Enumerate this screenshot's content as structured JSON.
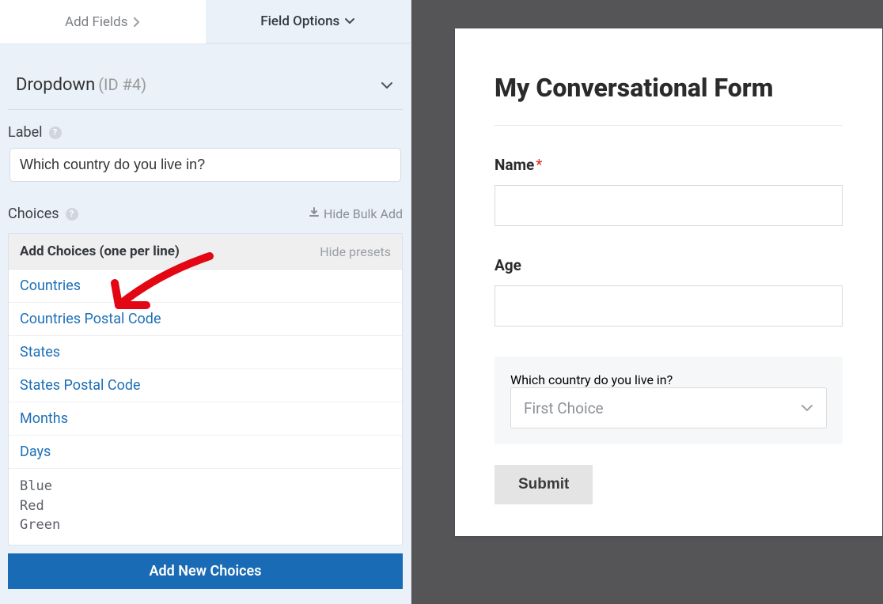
{
  "tabs": {
    "add_fields": "Add Fields",
    "field_options": "Field Options"
  },
  "section": {
    "title": "Dropdown",
    "id_label": "(ID #4)"
  },
  "label_field": {
    "label": "Label",
    "value": "Which country do you live in?"
  },
  "choices": {
    "label": "Choices",
    "hide_bulk": "Hide Bulk Add",
    "add_header": "Add Choices (one per line)",
    "hide_presets": "Hide presets",
    "presets": [
      "Countries",
      "Countries Postal Code",
      "States",
      "States Postal Code",
      "Months",
      "Days"
    ],
    "textarea_value": "Blue\nRed\nGreen",
    "add_btn": "Add New Choices"
  },
  "form": {
    "title": "My Conversational Form",
    "name_label": "Name",
    "required_mark": "*",
    "age_label": "Age",
    "dropdown_label": "Which country do you live in?",
    "dropdown_selected": "First Choice",
    "submit": "Submit"
  },
  "icons": {
    "help": "?",
    "download": "⬇"
  }
}
